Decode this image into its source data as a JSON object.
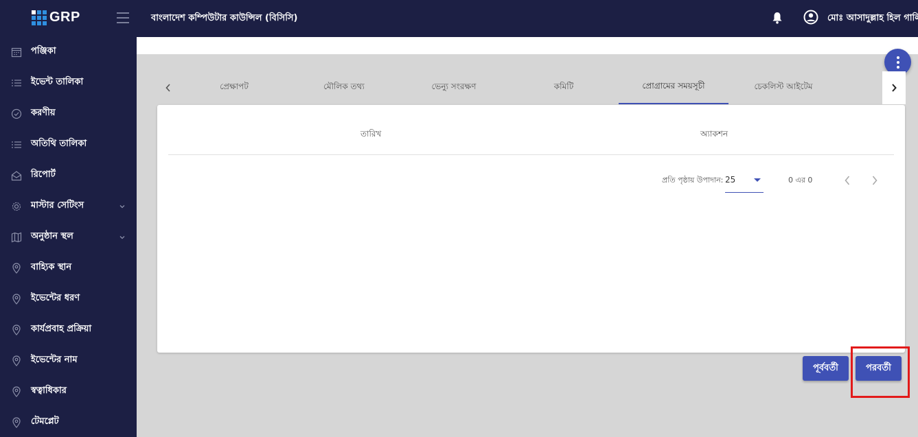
{
  "header": {
    "logo_text": "GRP",
    "org_title": "বাংলাদেশ কম্পিউটার কাউন্সিল (বিসিসি)",
    "user_name": "মোঃ আসাদুল্লাহ হিল গালিব",
    "icons": [
      "menu-icon",
      "bell-icon",
      "account-circle-icon"
    ]
  },
  "sidebar": {
    "items": [
      {
        "label": "পঞ্জিকা",
        "icon": "calendar-icon"
      },
      {
        "label": "ইভেন্ট তালিকা",
        "icon": "list-icon"
      },
      {
        "label": "করণীয়",
        "icon": "check-circle-icon"
      },
      {
        "label": "অতিথি তালিকা",
        "icon": "list-icon"
      },
      {
        "label": "রিপোর্ট",
        "icon": "mail-open-icon"
      },
      {
        "label": "মাস্টার সেটিংস",
        "icon": "gear-icon",
        "expandable": true
      },
      {
        "label": "অনুষ্ঠান স্থল",
        "icon": "map-icon",
        "expandable": true
      },
      {
        "label": "বাহ্যিক স্থান",
        "icon": "location-pin-icon"
      },
      {
        "label": "ইভেন্টের ধরণ",
        "icon": "location-pin-icon"
      },
      {
        "label": "কার্যপ্রবাহ প্রক্রিয়া",
        "icon": "location-pin-icon"
      },
      {
        "label": "ইভেন্টের নাম",
        "icon": "location-pin-icon"
      },
      {
        "label": "স্বত্বাধিকার",
        "icon": "location-pin-icon"
      },
      {
        "label": "টেমপ্লেট",
        "icon": "location-pin-icon"
      }
    ]
  },
  "tabs": {
    "items": [
      {
        "label": "প্রেক্ষাপট"
      },
      {
        "label": "মৌলিক তথ্য"
      },
      {
        "label": "ভেন্যু সংরক্ষণ"
      },
      {
        "label": "কমিটি"
      },
      {
        "label": "প্রোগ্রামের সময়সূচী",
        "active": true
      },
      {
        "label": "চেকলিস্ট আইটেম"
      }
    ],
    "prev_icon": "chevron-left-icon",
    "next_icon": "chevron-right-icon"
  },
  "table": {
    "columns": [
      "তারিখ",
      "অ্যাকশন"
    ],
    "rows": []
  },
  "paginator": {
    "items_per_page_label": "প্রতি পৃষ্ঠায় উপাদান:",
    "page_size": "25",
    "range_label": "0 এর 0"
  },
  "buttons": {
    "previous_label": "পূর্ববর্তী",
    "next_label": "পরবর্তী"
  },
  "colors": {
    "sidebar_bg": "#1c1f44",
    "accent": "#3f51b5",
    "highlight": "#e21a1a",
    "content_bg": "#d6d6d6"
  }
}
